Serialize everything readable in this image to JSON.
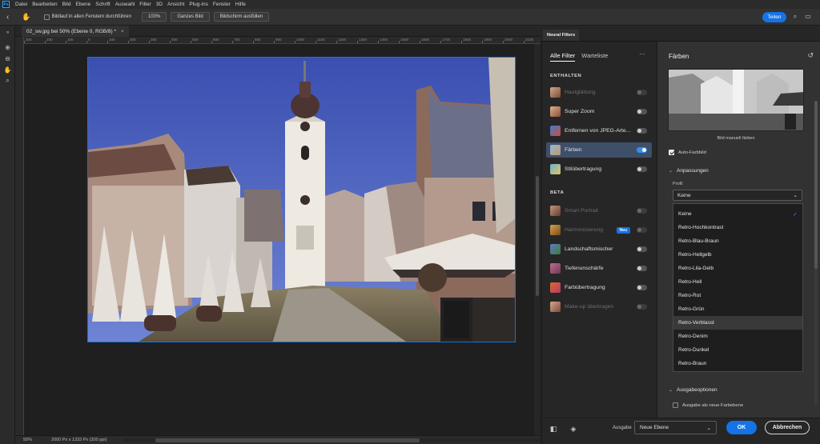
{
  "app": {
    "logo_text": "Ps"
  },
  "menu": [
    "Datei",
    "Bearbeiten",
    "Bild",
    "Ebene",
    "Schrift",
    "Auswahl",
    "Filter",
    "3D",
    "Ansicht",
    "Plug-ins",
    "Fenster",
    "Hilfe"
  ],
  "options": {
    "scroll_all_label": "Bildlauf in allen Fenstern durchführen",
    "zoom_100": "100%",
    "fit_screen": "Ganzes Bild",
    "fill_screen": "Bildschirm ausfüllen",
    "share": "Teilen"
  },
  "document": {
    "tab_title": "02_sw.jpg bei 50% (Ebene 0, RGB/8) *",
    "close_glyph": "×"
  },
  "ruler": {
    "h_ticks": [
      "300",
      "200",
      "100",
      "0",
      "100",
      "200",
      "300",
      "400",
      "500",
      "600",
      "700",
      "800",
      "900",
      "1000",
      "1100",
      "1200",
      "1300",
      "1400",
      "1500",
      "1600",
      "1700",
      "1800",
      "1900",
      "2000",
      "2100",
      "2200"
    ]
  },
  "status": {
    "zoom": "50%",
    "doc_info": "2000 Px x 1333 Px (300 ppi)"
  },
  "neural_filters": {
    "tab_label": "Neural Filters",
    "tabs": {
      "all": "Alle Filter",
      "waitlist": "Warteliste"
    },
    "more_glyph": "···",
    "section_included": "ENTHALTEN",
    "section_beta": "BETA",
    "included": [
      {
        "label": "Hautglättung",
        "state": "disabled"
      },
      {
        "label": "Super Zoom",
        "state": "off"
      },
      {
        "label": "Entfernen von JPEG-Arte...",
        "state": "off"
      },
      {
        "label": "Färben",
        "state": "on"
      },
      {
        "label": "Stilübertragung",
        "state": "off"
      }
    ],
    "beta": [
      {
        "label": "Smart Portrait",
        "state": "disabled"
      },
      {
        "label": "Harmonisierung",
        "state": "disabled",
        "badge": "Neu"
      },
      {
        "label": "Landschaftsmischer",
        "state": "off"
      },
      {
        "label": "Tiefenunschärfe",
        "state": "off"
      },
      {
        "label": "Farbübertragung",
        "state": "off"
      },
      {
        "label": "Make-up übertragen",
        "state": "disabled"
      }
    ]
  },
  "settings": {
    "title": "Färben",
    "preview_caption": "Bild manuell färben",
    "auto_color": "Auto-Farbbild",
    "adjustments": "Anpassungen",
    "profile_label": "Profil",
    "profile_value": "Keine",
    "profiles": [
      "Keine",
      "Retro-Hochkontrast",
      "Retro-Blau-Braun",
      "Retro-Hellgelb",
      "Retro-Lila-Gelb",
      "Retro-Hell",
      "Retro-Rot",
      "Retro-Grün",
      "Retro-Verblasst",
      "Retro-Denim",
      "Retro-Dunkel",
      "Retro-Braun"
    ],
    "selected_profile": "Keine",
    "hovered_profile": "Retro-Verblasst",
    "output_options": "Ausgabeoptionen",
    "output_new_layer": "Ausgabe als neue Farbebene"
  },
  "footer": {
    "output_label": "Ausgabe",
    "output_value": "Neue Ebene",
    "ok": "OK",
    "cancel": "Abbrechen"
  },
  "colors": {
    "accent": "#1473e6",
    "toggle_on": "#378ef0",
    "selected_row": "#3e4f6a"
  }
}
